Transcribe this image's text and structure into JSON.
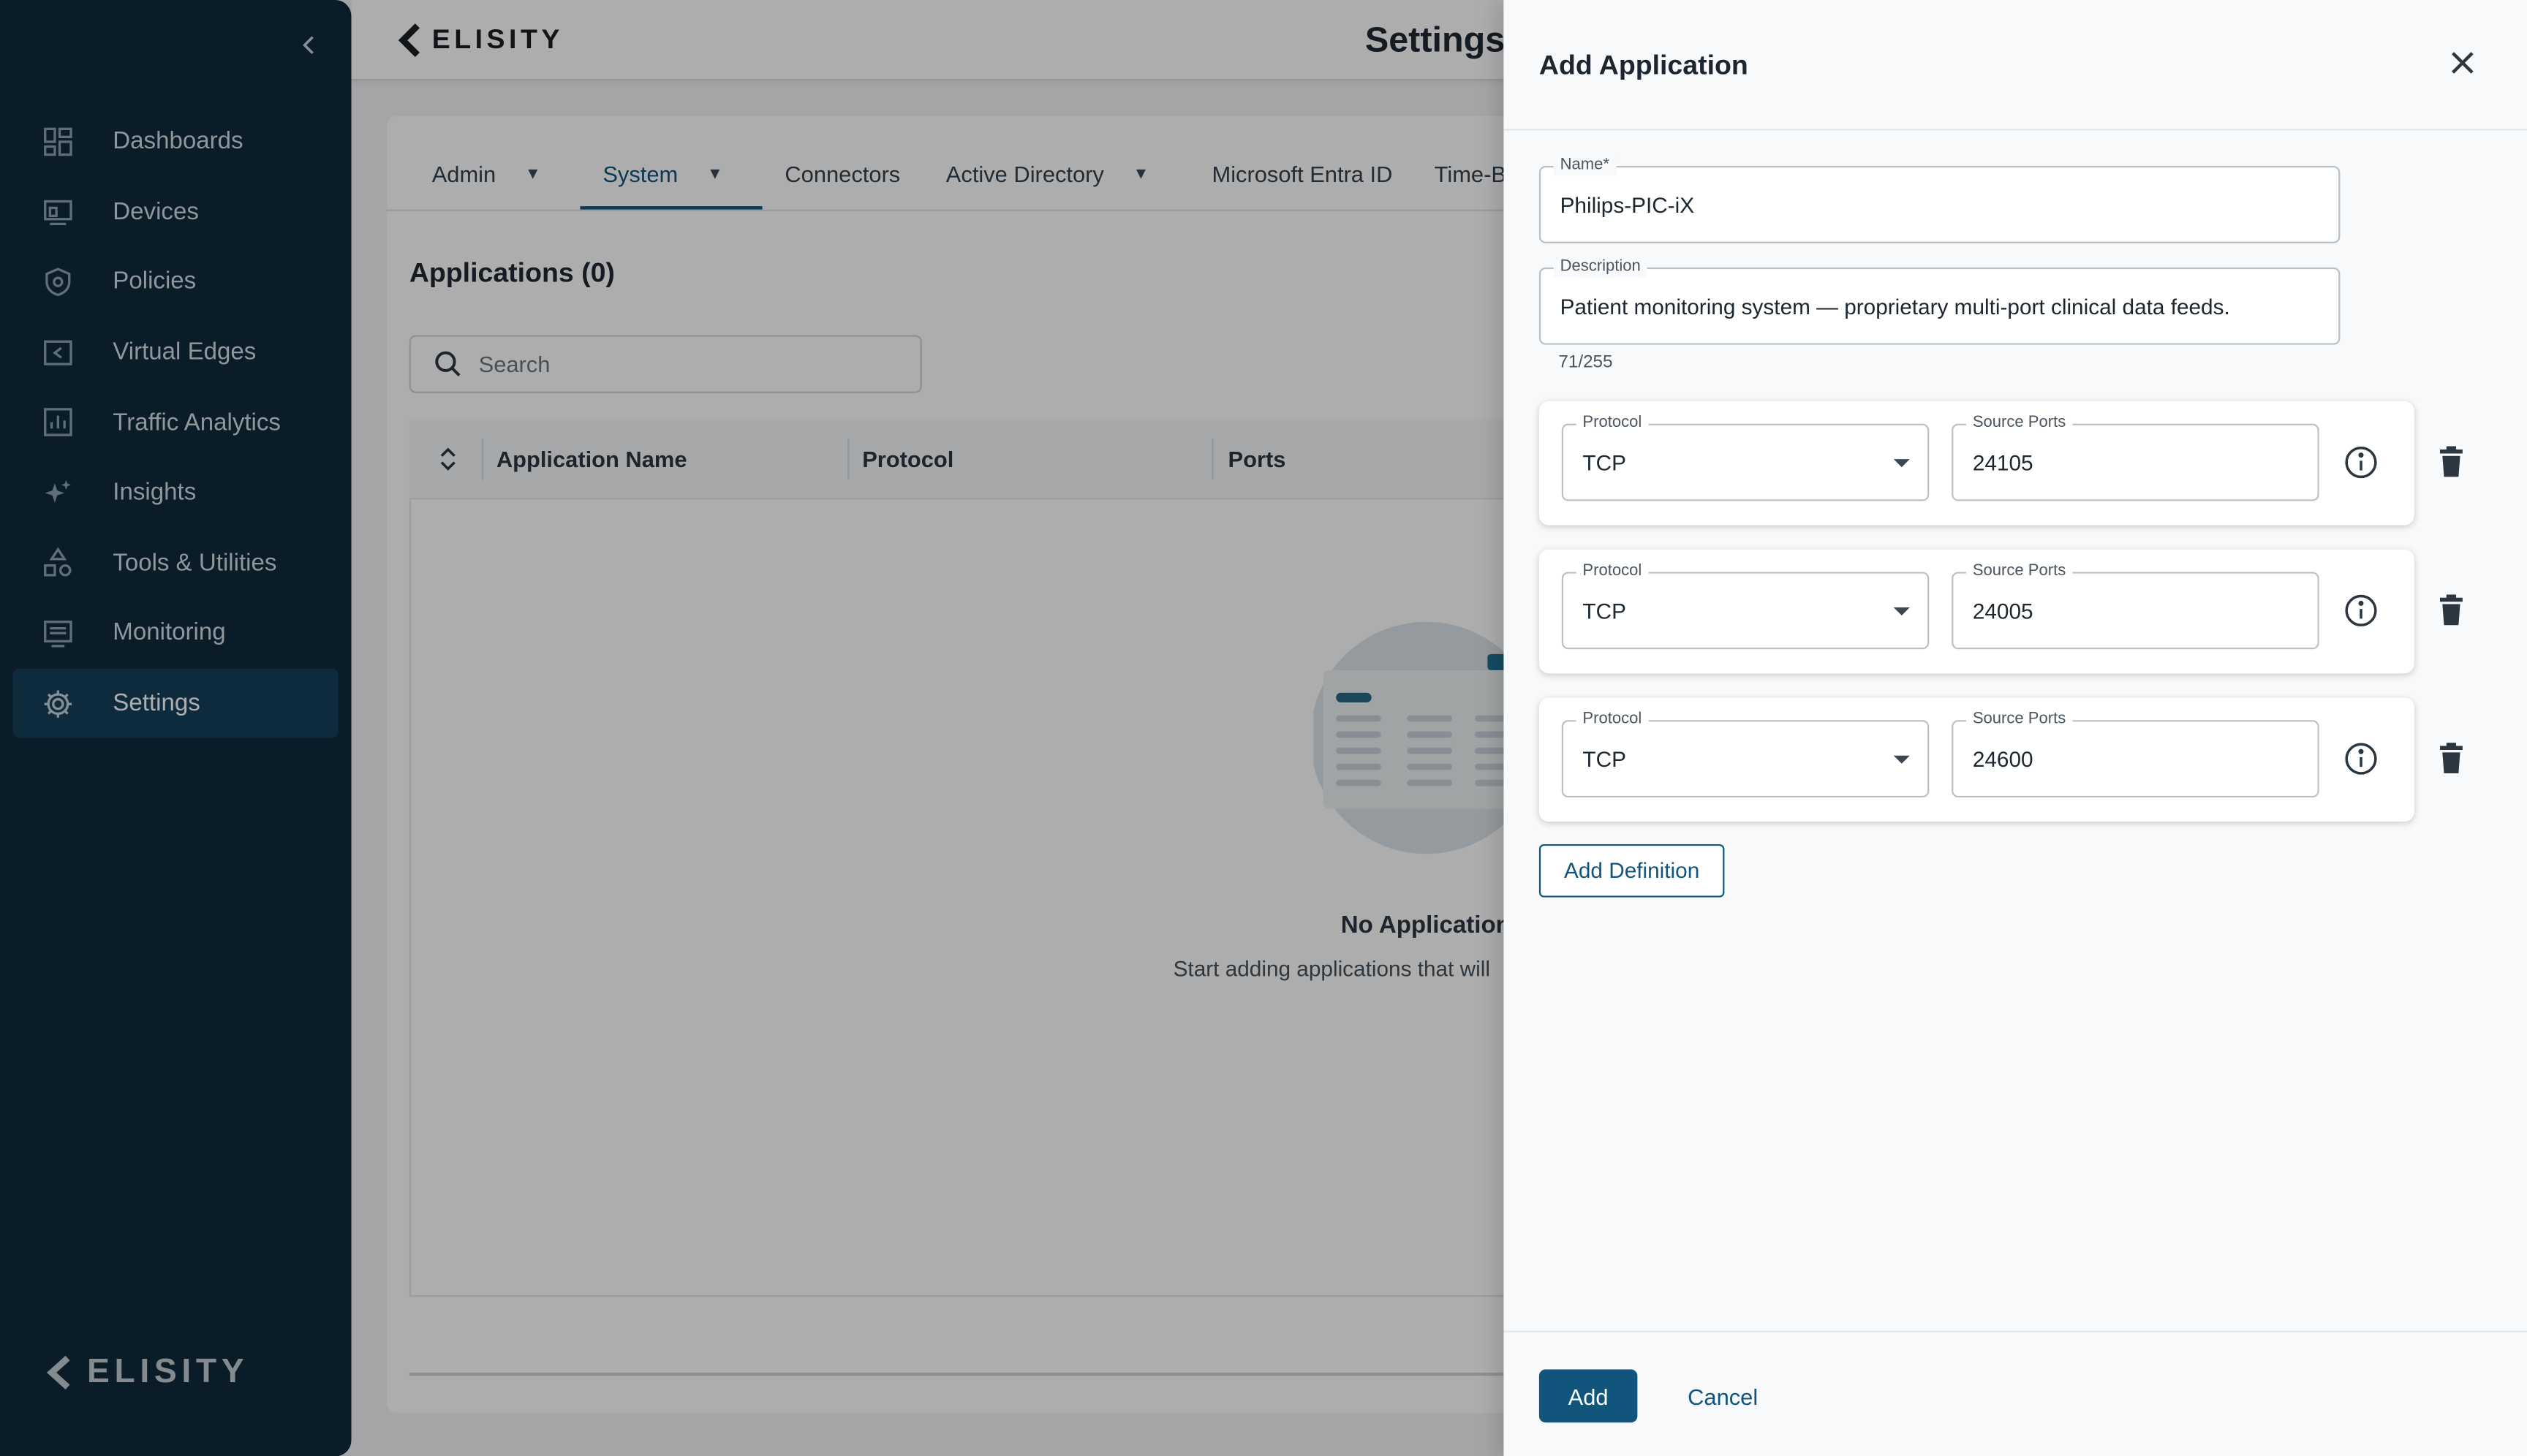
{
  "brand": {
    "name": "ELISITY"
  },
  "header": {
    "title": "Settings"
  },
  "sidebar": {
    "collapse_icon": "chevron-left-icon",
    "items": [
      {
        "label": "Dashboards",
        "icon": "dashboard-grid-icon"
      },
      {
        "label": "Devices",
        "icon": "devices-icon"
      },
      {
        "label": "Policies",
        "icon": "shield-icon"
      },
      {
        "label": "Virtual Edges",
        "icon": "virtual-edge-icon"
      },
      {
        "label": "Traffic Analytics",
        "icon": "bar-chart-icon"
      },
      {
        "label": "Insights",
        "icon": "sparkle-icon"
      },
      {
        "label": "Tools & Utilities",
        "icon": "tools-shapes-icon"
      },
      {
        "label": "Monitoring",
        "icon": "monitor-list-icon"
      },
      {
        "label": "Settings",
        "icon": "gear-icon",
        "active": true
      }
    ]
  },
  "tabs": [
    {
      "label": "Admin",
      "has_menu": true
    },
    {
      "label": "System",
      "has_menu": true,
      "active": true
    },
    {
      "label": "Connectors"
    },
    {
      "label": "Active Directory",
      "has_menu": true
    },
    {
      "label": "Microsoft Entra ID"
    },
    {
      "label": "Time-B"
    }
  ],
  "applications": {
    "title": "Applications (0)",
    "search_placeholder": "Search",
    "columns": [
      "Application Name",
      "Protocol",
      "Ports"
    ],
    "empty_title": "No Application",
    "empty_subtitle": "Start adding applications that will"
  },
  "drawer": {
    "title": "Add Application",
    "name_label": "Name",
    "required_marker": "*",
    "name_value": "Philips-PIC-iX",
    "description_label": "Description",
    "description_value": "Patient monitoring system — proprietary multi-port clinical data feeds.",
    "counter": "71/255",
    "protocol_label": "Protocol",
    "ports_label": "Source Ports",
    "definitions": [
      {
        "protocol": "TCP",
        "source_ports": "24105"
      },
      {
        "protocol": "TCP",
        "source_ports": "24005"
      },
      {
        "protocol": "TCP",
        "source_ports": "24600"
      }
    ],
    "add_definition_label": "Add Definition",
    "add_label": "Add",
    "cancel_label": "Cancel"
  },
  "colors": {
    "sidebar_bg": "#0e2a3b",
    "accent": "#11557c",
    "active_nav": "#16405a"
  }
}
